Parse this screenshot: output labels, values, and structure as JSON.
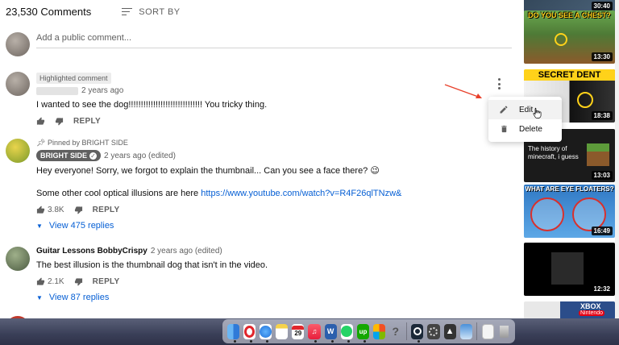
{
  "header": {
    "comment_count": "23,530 Comments",
    "sort_label": "SORT BY"
  },
  "add_comment": {
    "placeholder": "Add a public comment..."
  },
  "comments": [
    {
      "tag": "Highlighted comment",
      "time": "2 years ago",
      "text": "I wanted to see the dog!!!!!!!!!!!!!!!!!!!!!!!!!!!!!! You tricky thing.",
      "reply_label": "REPLY"
    },
    {
      "pinned": "Pinned by BRIGHT SIDE",
      "author": "BRIGHT SIDE",
      "time": "2 years ago (edited)",
      "text": "Hey everyone! Sorry, we forgot to explain the thumbnail... Can you see a face there? 😉",
      "text2": "Some other cool optical illusions are here",
      "link": "https://www.youtube.com/watch?v=R4F26qlTNzw&",
      "likes": "3.8K",
      "reply_label": "REPLY",
      "view_replies": "View 475 replies"
    },
    {
      "author": "Guitar Lessons BobbyCrispy",
      "time": "2 years ago (edited)",
      "text": "The best illusion is the thumbnail dog that isn't in the video.",
      "likes": "2.1K",
      "reply_label": "REPLY",
      "view_replies": "View 87 replies"
    }
  ],
  "context_menu": {
    "edit_label": "Edit",
    "delete_label": "Delete"
  },
  "sidebar": {
    "videos": [
      {
        "duration": "30:40"
      },
      {
        "title": "DO YOU SEE A CHEST?",
        "duration": "13:30"
      },
      {
        "title": "SECRET DENT",
        "duration": "18:38"
      },
      {
        "title": "The history of minecraft, i guess",
        "duration": "13:03"
      },
      {
        "title": "WHAT ARE EYE FLOATERS?",
        "duration": "16:49"
      },
      {
        "duration": "12:32"
      },
      {
        "title": "XBOX",
        "subtitle": "Nintendo"
      }
    ]
  },
  "dock": {
    "calendar_day": "29",
    "colors": {
      "finder": "#3d8fe0",
      "opera": "#e0262c",
      "safari": "#2a7de1",
      "notes": "#f5d24b",
      "music": "#f4424f",
      "word": "#2b5fad",
      "upwork": "#14a800"
    }
  },
  "colors": {
    "link": "#065fd4",
    "muted": "#606060",
    "arrow": "#e8402a"
  }
}
